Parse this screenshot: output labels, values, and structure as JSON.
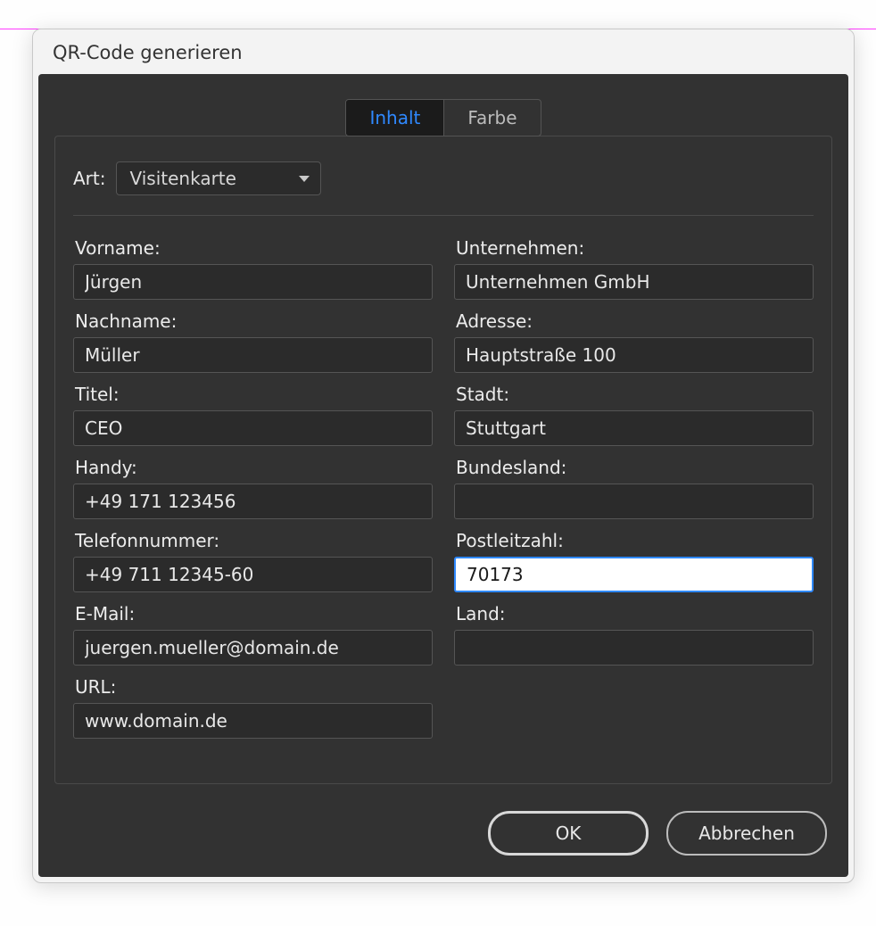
{
  "dialog": {
    "title": "QR-Code generieren",
    "tabs": {
      "content": "Inhalt",
      "color": "Farbe"
    },
    "type_label": "Art:",
    "type_value": "Visitenkarte",
    "fields": {
      "firstname": {
        "label": "Vorname:",
        "value": "Jürgen"
      },
      "lastname": {
        "label": "Nachname:",
        "value": "Müller"
      },
      "title": {
        "label": "Titel:",
        "value": "CEO"
      },
      "mobile": {
        "label": "Handy:",
        "value": "+49 171 123456"
      },
      "phone": {
        "label": "Telefonnummer:",
        "value": "+49 711 12345-60"
      },
      "email": {
        "label": "E-Mail:",
        "value": "juergen.mueller@domain.de"
      },
      "url": {
        "label": "URL:",
        "value": "www.domain.de"
      },
      "company": {
        "label": "Unternehmen:",
        "value": "Unternehmen GmbH"
      },
      "address": {
        "label": "Adresse:",
        "value": "Hauptstraße 100"
      },
      "city": {
        "label": "Stadt:",
        "value": "Stuttgart"
      },
      "state": {
        "label": "Bundesland:",
        "value": ""
      },
      "zip": {
        "label": "Postleitzahl:",
        "value": "70173"
      },
      "country": {
        "label": "Land:",
        "value": ""
      }
    },
    "buttons": {
      "ok": "OK",
      "cancel": "Abbrechen"
    }
  }
}
